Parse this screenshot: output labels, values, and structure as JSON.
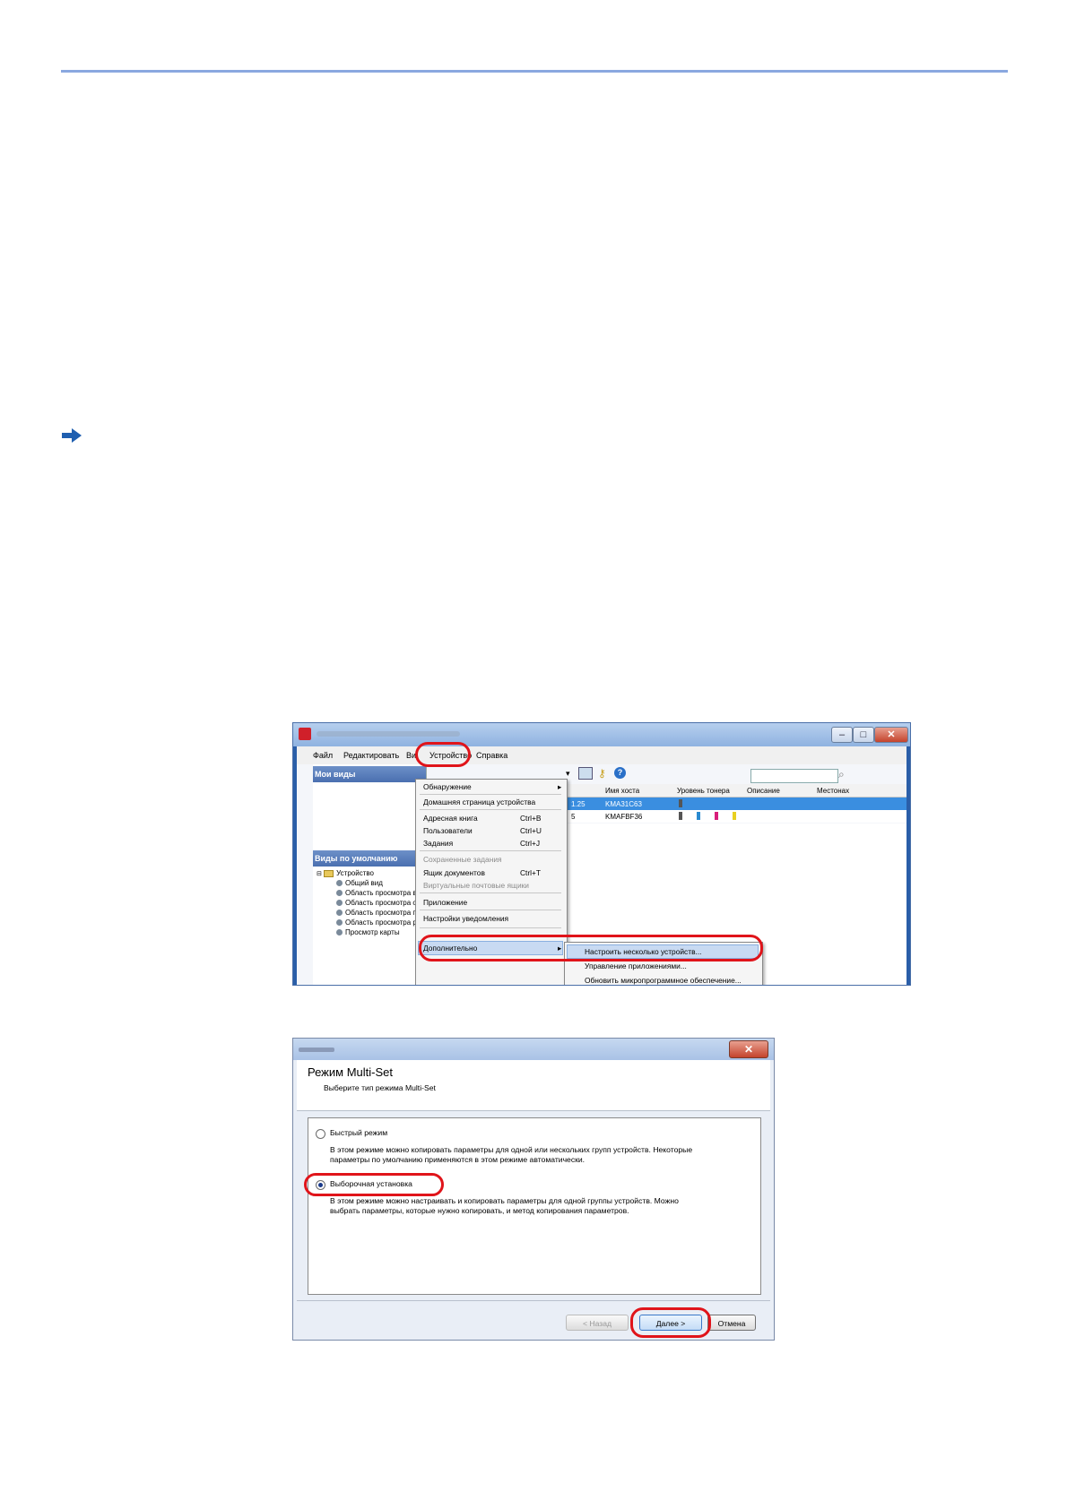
{
  "screenshot1": {
    "menubar": [
      "Файл",
      "Редактировать",
      "Ви",
      "Устройство",
      "Справка"
    ],
    "panels": {
      "my_views": "Мои виды",
      "default_views": "Виды по умолчанию"
    },
    "tree": {
      "root": "Устройство",
      "items": [
        "Общий вид",
        "Область просмотра вос",
        "Область просмотра оче",
        "Область просмотра про",
        "Область просмотра рес",
        "Просмотр карты"
      ]
    },
    "columns": [
      "Имя хоста",
      "Уровень тонера",
      "Описание",
      "Местонах"
    ],
    "rows": [
      {
        "ip_tail": "1.25",
        "host": "KMA31C63"
      },
      {
        "ip_tail": "5",
        "host": "KMAFBF36"
      }
    ],
    "device_menu": {
      "items": [
        {
          "label": "Обнаружение",
          "shortcut": "",
          "dim": false,
          "arrow": true
        },
        {
          "label": "Домашняя страница устройства",
          "shortcut": "",
          "dim": false
        },
        {
          "label": "Адресная книга",
          "shortcut": "Ctrl+B",
          "dim": false
        },
        {
          "label": "Пользователи",
          "shortcut": "Ctrl+U",
          "dim": false
        },
        {
          "label": "Задания",
          "shortcut": "Ctrl+J",
          "dim": false
        },
        {
          "label": "Сохраненные задания",
          "shortcut": "",
          "dim": true
        },
        {
          "label": "Ящик документов",
          "shortcut": "Ctrl+T",
          "dim": false
        },
        {
          "label": "Виртуальные почтовые ящики",
          "shortcut": "",
          "dim": true
        },
        {
          "label": "Приложение",
          "shortcut": "",
          "dim": false
        },
        {
          "label": "Настройки уведомления",
          "shortcut": "",
          "dim": false
        },
        {
          "label": "Дополнительно",
          "shortcut": "",
          "dim": false,
          "arrow": true
        }
      ]
    },
    "submenu": [
      "Настроить несколько устройств...",
      "Управление приложениями...",
      "Обновить микропрограммное обеспечение..."
    ],
    "toner_colors": [
      "#555555",
      "#2a8ad0",
      "#d81e7a",
      "#e8d020"
    ]
  },
  "screenshot2": {
    "title": "Режим Multi-Set",
    "subtitle": "Выберите тип режима Multi-Set",
    "options": [
      {
        "label": "Быстрый режим",
        "selected": false,
        "desc1": "В этом режиме можно копировать параметры для одной или нескольких групп устройств. Некоторые",
        "desc2": "параметры по умолчанию применяются в этом режиме автоматически."
      },
      {
        "label": "Выборочная установка",
        "selected": true,
        "desc1": "В этом режиме можно настраивать и копировать параметры для одной группы устройств. Можно",
        "desc2": "выбрать параметры, которые нужно копировать, и метод копирования параметров."
      }
    ],
    "buttons": {
      "back": "< Назад",
      "next": "Далее >",
      "cancel": "Отмена"
    }
  }
}
